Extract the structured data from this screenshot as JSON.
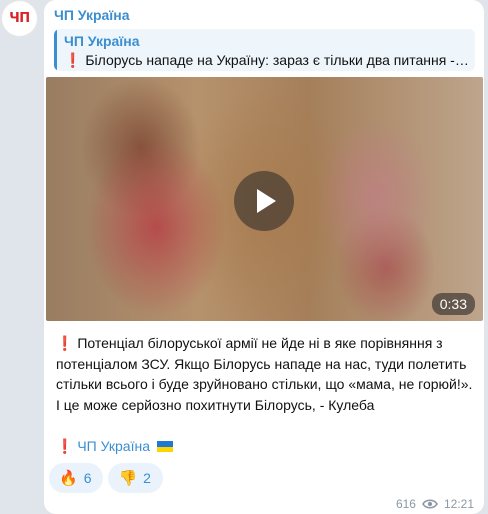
{
  "avatar": {
    "text": "ЧП"
  },
  "message": {
    "channel": "ЧП Україна",
    "reply": {
      "author": "ЧП Україна",
      "excl": "❗",
      "text": "Білорусь нападе на Україну: зараз є тільки два питання - ..."
    },
    "video": {
      "duration": "0:33"
    },
    "body_excl": "❗",
    "body": "Потенціал білоруської армії не йде ні в яке порівняння з потенціалом ЗСУ. Якщо Білорусь нападе на нас, туди полетить стільки всього і буде зруйновано стільки, що «мама, не горюй!». І це може серйозно похитнути Білорусь, - Кулеба",
    "signature": {
      "excl": "❗",
      "name": "ЧП Україна"
    },
    "reactions": [
      {
        "emoji": "🔥",
        "icon": "fire-icon",
        "count": "6"
      },
      {
        "emoji": "👎",
        "icon": "thumbs-down-icon",
        "count": "2"
      }
    ],
    "views": "616",
    "time": "12:21"
  },
  "colors": {
    "accent": "#3b8fd0",
    "background": "#dfe5ea",
    "exclamation": "#d81b1b",
    "meta": "#8c98a3"
  }
}
